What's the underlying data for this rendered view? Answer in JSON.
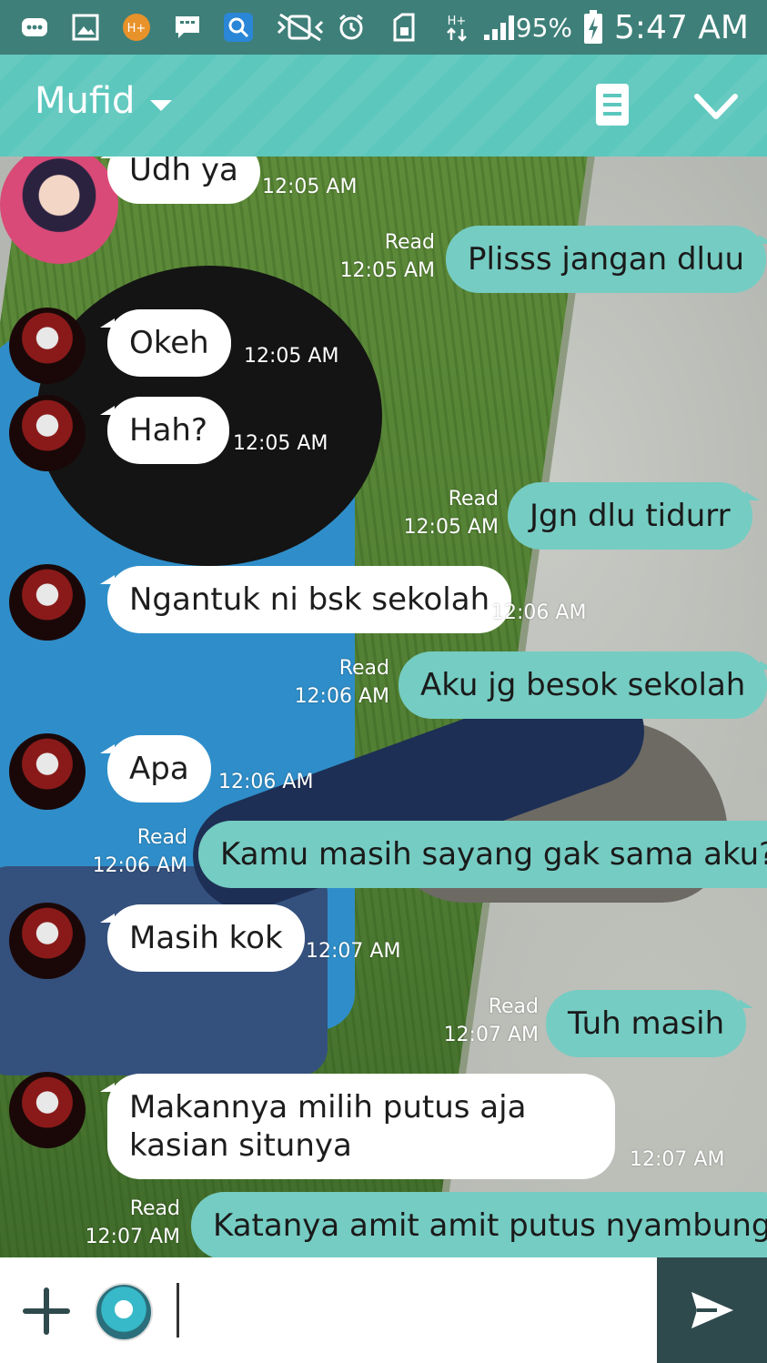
{
  "status_bar": {
    "battery_percent": "95%",
    "time": "5:47 AM",
    "icons": [
      "chat-bubble-icon",
      "image-icon",
      "h-plus-app-icon",
      "message-icon",
      "search-app-icon",
      "vibrate-mute-icon",
      "alarm-icon",
      "sim-icon",
      "data-hplus-icon",
      "signal-icon",
      "battery-charging-icon"
    ]
  },
  "header": {
    "title": "Mufid",
    "icons": [
      "dropdown-caret-icon",
      "notes-icon",
      "chevron-down-icon"
    ]
  },
  "messages": [
    {
      "dir": "in",
      "text": "Udh ya",
      "time": "12:05 AM",
      "read": ""
    },
    {
      "dir": "out",
      "text": "Plisss jangan dluu",
      "time": "12:05 AM",
      "read": "Read"
    },
    {
      "dir": "in",
      "text": "Okeh",
      "time": "12:05 AM",
      "read": ""
    },
    {
      "dir": "in",
      "text": "Hah?",
      "time": "12:05 AM",
      "read": ""
    },
    {
      "dir": "out",
      "text": "Jgn dlu tidurr",
      "time": "12:05 AM",
      "read": "Read"
    },
    {
      "dir": "in",
      "text": "Ngantuk ni bsk sekolah",
      "time": "12:06 AM",
      "read": ""
    },
    {
      "dir": "out",
      "text": "Aku jg besok sekolah",
      "time": "12:06 AM",
      "read": "Read"
    },
    {
      "dir": "in",
      "text": "Apa",
      "time": "12:06 AM",
      "read": ""
    },
    {
      "dir": "out",
      "text": "Kamu masih sayang gak sama aku?",
      "time": "12:06 AM",
      "read": "Read"
    },
    {
      "dir": "in",
      "text": "Masih kok",
      "time": "12:07 AM",
      "read": ""
    },
    {
      "dir": "out",
      "text": "Tuh masih",
      "time": "12:07 AM",
      "read": "Read"
    },
    {
      "dir": "in",
      "text": "Makannya milih putus aja kasian situnya",
      "time": "12:07 AM",
      "read": ""
    },
    {
      "dir": "out",
      "text": "Katanya amit amit putus nyambung",
      "time": "12:07 AM",
      "read": "Read"
    }
  ],
  "input": {
    "value": "",
    "icons": [
      "plus-icon",
      "sticker-avatar-icon",
      "send-icon"
    ]
  },
  "colors": {
    "status_bar": "#3e7f79",
    "header": "#5cc7bd",
    "outgoing_bubble": "#75ccc2",
    "incoming_bubble": "#ffffff",
    "send_button": "#2f4a4d"
  }
}
